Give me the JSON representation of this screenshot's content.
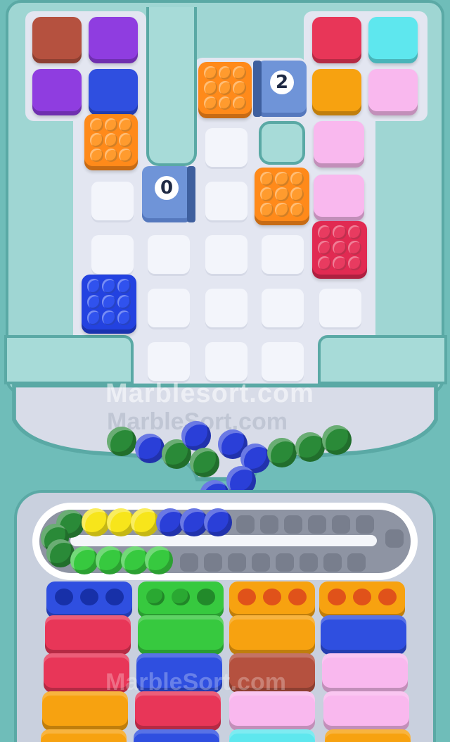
{
  "watermark": {
    "main": "Marblesort.com",
    "shadow": "MarbleSort.com",
    "bottom": "MarbleSort.com"
  },
  "tunnels": [
    {
      "label": "0",
      "color": "#6f94d8"
    },
    {
      "label": "2",
      "color": "#6f94d8"
    }
  ],
  "colors": {
    "brown": "#b5513f",
    "purple": "#8f3de0",
    "blue": "#2f4fe0",
    "orange": "#ff8a1a",
    "red": "#e83658",
    "cyan": "#5ee7ee",
    "amber": "#f7a210",
    "pink": "#f9a8e8",
    "green": "#37c93f",
    "dark_green": "#2a8a38",
    "yellow": "#f7e51b",
    "navy": "#2a3fd8"
  },
  "marbles_in_funnel": 14,
  "conveyor": {
    "green": 6,
    "yellow": 3,
    "blue": 3,
    "empty_slots": 14
  },
  "trays": [
    {
      "column": 1,
      "top": "blue",
      "stack": [
        "red",
        "red",
        "orange"
      ]
    },
    {
      "column": 2,
      "top": "green",
      "stack": [
        "green",
        "blue",
        "red"
      ]
    },
    {
      "column": 3,
      "top": "orange",
      "stack": [
        "orange",
        "brown",
        "pink"
      ]
    },
    {
      "column": 4,
      "top": "orange",
      "stack": [
        "blue",
        "pink",
        "pink"
      ]
    }
  ]
}
